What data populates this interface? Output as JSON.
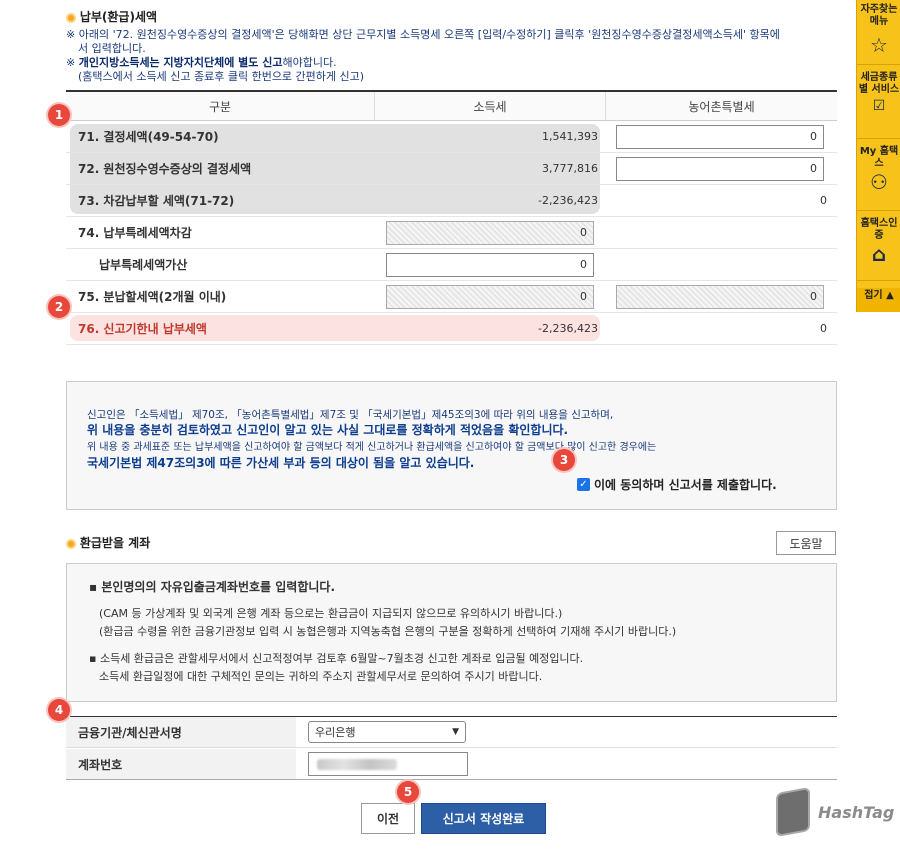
{
  "section1": {
    "title": "납부(환급)세액",
    "notice1_line1": "※ 아래의 '72. 원천징수영수증상의 결정세액'은 당해화면 상단 근무지별 소득명세 오른쪽 [입력/수정하기] 클릭후 '원천징수영수증상결정세액소득세' 항목에",
    "notice1_line2": "서 입력합니다.",
    "notice2_pre": "※ ",
    "notice2_bold": "개인지방소득세는 지방자치단체에 별도 신고",
    "notice2_post": "해야합니다.",
    "notice3": "(홈택스에서 소득세 신고 종료후 클릭 한번으로 간편하게 신고)"
  },
  "table": {
    "headers": [
      "구분",
      "소득세",
      "농어촌특별세"
    ],
    "rows": [
      {
        "label": "71. 결정세액(49-54-70)",
        "income": "1,541,393",
        "rural": "0"
      },
      {
        "label": "72. 원천징수영수증상의 결정세액",
        "income": "3,777,816",
        "rural": "0"
      },
      {
        "label": "73. 차감납부할 세액(71-72)",
        "income": "-2,236,423",
        "rural": "0"
      },
      {
        "label": "74. 납부특례세액차감",
        "income": "0",
        "rural": ""
      },
      {
        "label": "납부특례세액가산",
        "income": "0",
        "rural": ""
      },
      {
        "label": "75. 분납할세액(2개월 이내)",
        "income": "0",
        "rural": "0"
      },
      {
        "label": "76. 신고기한내 납부세액",
        "income": "-2,236,423",
        "rural": "0"
      }
    ]
  },
  "declaration": {
    "line1": "신고인은 「소득세법」 제70조, 「농어촌특별세법」제7조 및 「국세기본법」제45조의3에 따라 위의 내용을 신고하며,",
    "line2": "위 내용을 충분히 검토하였고 신고인이 알고 있는 사실 그대로를 정확하게 적었음을 확인합니다.",
    "line3": "위 내용 중 과세표준 또는 납부세액을 신고하여야 할 금액보다 적게 신고하거나 환급세액을 신고하여야 할 금액보다 많이 신고한 경우에는",
    "line4": "국세기본법 제47조의3에 따른 가산세 부과 등의 대상이 됨을 알고 있습니다.",
    "agree_label": "이에 동의하며 신고서를 제출합니다."
  },
  "section2": {
    "title": "환급받을 계좌",
    "help_button": "도움말",
    "info1_title": "본인명의의 자유입출금계좌번호를 입력합니다.",
    "info1_sub1": "(CAM 등 가상계좌 및 외국계 은행 계좌 등으로는 환급금이 지급되지 않으므로 유의하시기 바랍니다.)",
    "info1_sub2": "(환급금 수령을 위한 금융기관정보 입력 시 농협은행과 지역농축협 은행의 구분을 정확하게 선택하여 기재해 주시기 바랍니다.)",
    "info2_line1": "소득세 환급금은 관할세무서에서 신고적정여부 검토후 6월말~7월초경 신고한 계좌로 입금될 예정입니다.",
    "info2_line2": "소득세 환급일정에 대한 구체적인 문의는 귀하의 주소지 관할세무서로 문의하여 주시기 바랍니다.",
    "bank_label": "금융기관/체신관서명",
    "bank_value": "우리은행",
    "account_label": "계좌번호",
    "account_value": ""
  },
  "buttons": {
    "prev": "이전",
    "complete": "신고서 작성완료"
  },
  "badges": [
    "1",
    "2",
    "3",
    "4",
    "5"
  ],
  "sidebar": {
    "item1": "자주찾는 메뉴",
    "item2": "세금종류별 서비스",
    "item3": "My 홈택스",
    "item4": "홈택스인증",
    "fold": "접기 ▲"
  },
  "watermark": "HashTag",
  "colors": {
    "accent_blue": "#2d5fa6",
    "badge_red": "#e8473b",
    "sidebar_yellow": "#f7c21a",
    "notice_blue": "#1a3a7a"
  }
}
